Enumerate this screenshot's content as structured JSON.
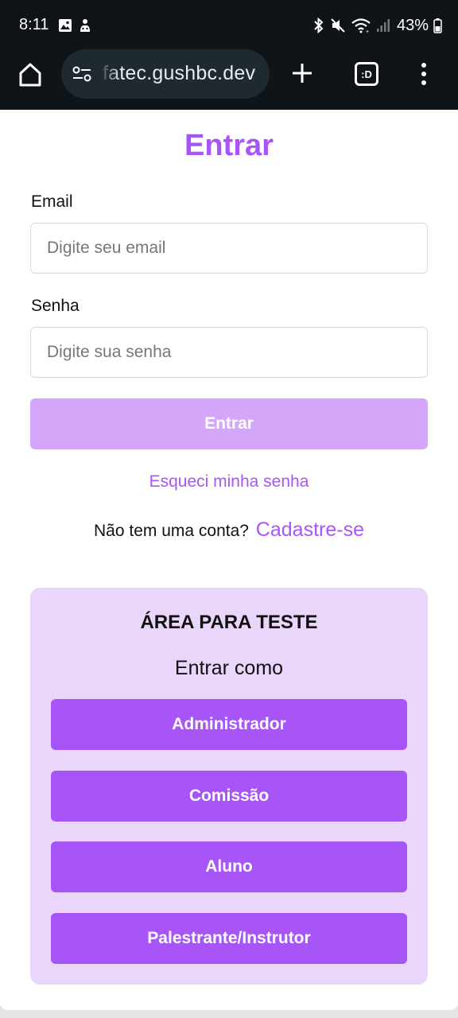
{
  "status_bar": {
    "time": "8:11",
    "battery": "43%"
  },
  "browser": {
    "url": "fatec.gushbc.dev",
    "tabs_label": ":D"
  },
  "login": {
    "title": "Entrar",
    "email_label": "Email",
    "email_placeholder": "Digite seu email",
    "email_value": "",
    "password_label": "Senha",
    "password_placeholder": "Digite sua senha",
    "password_value": "",
    "submit_label": "Entrar",
    "forgot_password": "Esqueci minha senha",
    "no_account_text": "Não tem uma conta?",
    "signup_link": "Cadastre-se"
  },
  "test_area": {
    "title": "ÁREA PARA TESTE",
    "subtitle": "Entrar como",
    "roles": [
      "Administrador",
      "Comissão",
      "Aluno",
      "Palestrante/Instrutor"
    ]
  },
  "colors": {
    "accent": "#a855f7",
    "accent_disabled": "#d3a6f9",
    "panel_bg": "#ead5fb",
    "chrome_bg": "#0f1418"
  }
}
